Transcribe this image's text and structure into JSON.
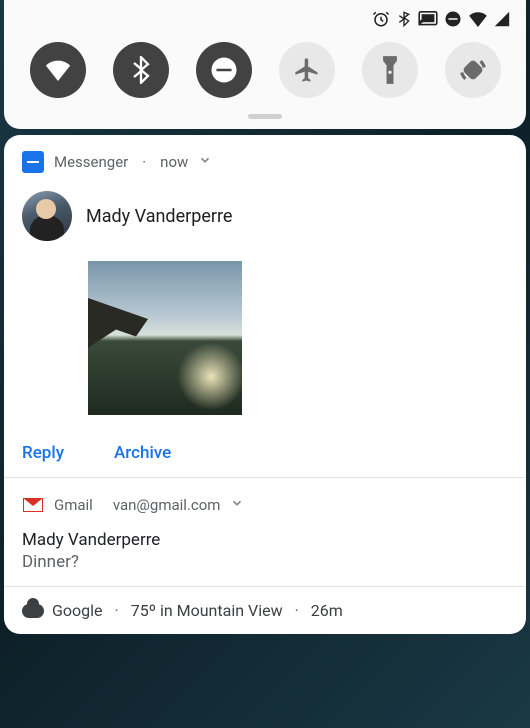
{
  "status_bar": {
    "icons": [
      "alarm",
      "bluetooth",
      "cast",
      "dnd",
      "wifi",
      "cellular"
    ]
  },
  "quick_settings": {
    "tiles": [
      {
        "name": "wifi",
        "on": true
      },
      {
        "name": "bluetooth",
        "on": true
      },
      {
        "name": "dnd",
        "on": true
      },
      {
        "name": "airplane",
        "on": false
      },
      {
        "name": "flashlight",
        "on": false
      },
      {
        "name": "rotation",
        "on": false
      }
    ]
  },
  "notifications": {
    "messenger": {
      "app_name": "Messenger",
      "time": "now",
      "sender": "Mady Vanderperre",
      "actions": {
        "reply": "Reply",
        "archive": "Archive"
      }
    },
    "gmail": {
      "app_name": "Gmail",
      "account": "van@gmail.com",
      "sender": "Mady Vanderperre",
      "subject": "Dinner?"
    },
    "weather": {
      "app_name": "Google",
      "summary": "75º in Mountain View",
      "time": "26m"
    }
  }
}
